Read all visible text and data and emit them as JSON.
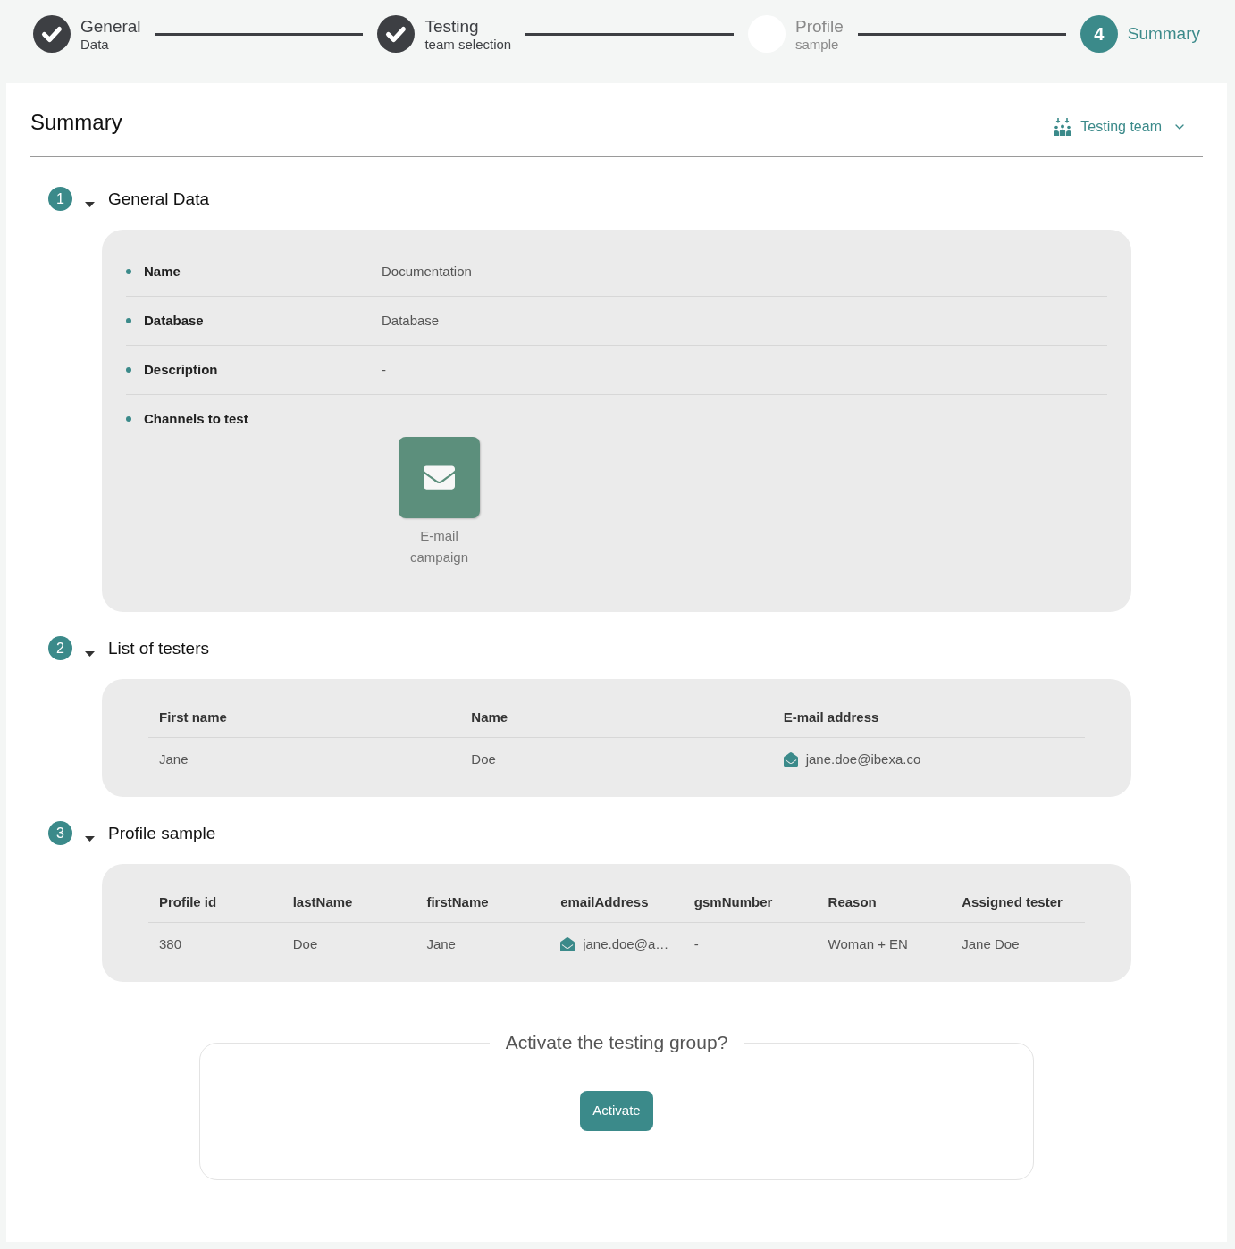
{
  "stepper": {
    "steps": [
      {
        "title": "General",
        "subtitle": "Data",
        "completed": true,
        "selected": false
      },
      {
        "title": "Testing",
        "subtitle": "team selection",
        "completed": true,
        "selected": false
      },
      {
        "title": "Profile",
        "subtitle": "sample",
        "completed": false,
        "selected": false
      },
      {
        "title": "Summary",
        "number": "4",
        "completed": false,
        "selected": true
      }
    ]
  },
  "summary": {
    "title": "Summary",
    "team_selector": {
      "label": "Testing team"
    }
  },
  "sections": [
    {
      "number": "1",
      "title": "General Data",
      "expanded": true,
      "kind": "details",
      "fields": [
        {
          "kind": "text",
          "label": "Name",
          "value": "Documentation"
        },
        {
          "kind": "text",
          "label": "Database",
          "value": "Database"
        },
        {
          "kind": "text",
          "label": "Description",
          "value": "-"
        },
        {
          "kind": "channels",
          "label": "Channels to test",
          "channels": [
            {
              "label": "E-mail campaign"
            }
          ]
        }
      ]
    },
    {
      "number": "2",
      "title": "List of testers",
      "expanded": true,
      "kind": "table",
      "columns": [
        "First name",
        "Name",
        "E-mail address"
      ],
      "rows": [
        [
          {
            "kind": "text",
            "text": "Jane"
          },
          {
            "kind": "text",
            "text": "Doe"
          },
          {
            "kind": "email",
            "text": "jane.doe@ibexa.co"
          }
        ]
      ]
    },
    {
      "number": "3",
      "title": "Profile sample",
      "expanded": true,
      "kind": "table",
      "columns": [
        "Profile id",
        "lastName",
        "firstName",
        "emailAddress",
        "gsmNumber",
        "Reason",
        "Assigned tester"
      ],
      "rows": [
        [
          {
            "kind": "text",
            "text": "380"
          },
          {
            "kind": "text",
            "text": "Doe"
          },
          {
            "kind": "text",
            "text": "Jane"
          },
          {
            "kind": "email",
            "text": "jane.doe@a…"
          },
          {
            "kind": "text",
            "text": "-"
          },
          {
            "kind": "text",
            "text": "Woman + EN"
          },
          {
            "kind": "text",
            "text": "Jane Doe"
          }
        ]
      ]
    }
  ],
  "confirm": {
    "prompt": "Activate the testing group?",
    "button": "Activate"
  }
}
